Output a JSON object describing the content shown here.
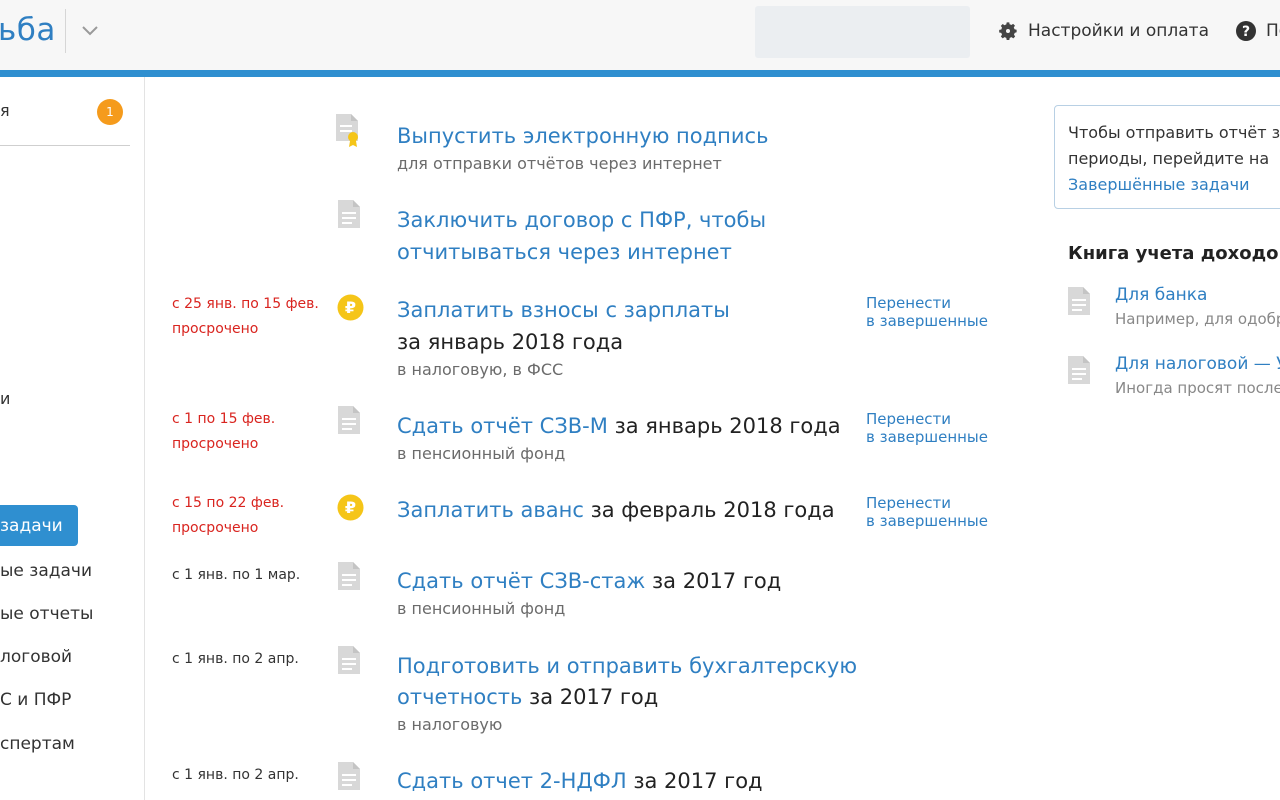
{
  "header": {
    "logo_text": "ьба",
    "settings_label": "Настройки и оплата",
    "help_label": "По"
  },
  "sidebar": {
    "top_item": "я",
    "badge_count": "1",
    "lone_item": "и",
    "active_item": "задачи",
    "items": [
      "ые задачи",
      "ые отчеты",
      "логовой",
      "С и ПФР",
      "спертам"
    ]
  },
  "tasks": [
    {
      "due": [],
      "icon": "document-certificate-icon",
      "title_link": "Выпустить электронную подпись",
      "title_rest": "",
      "title_line2_link": "",
      "title_line2_rest": "",
      "subtitle": "для отправки отчётов через интернет",
      "move": null
    },
    {
      "due": [],
      "icon": "document-icon",
      "title_link": "Заключить договор с ПФР, чтобы",
      "title_rest": "",
      "title_line2_link": "отчитываться через интернет",
      "title_line2_rest": "",
      "subtitle": "",
      "move": null
    },
    {
      "due": [
        "с 25 янв. по 15 фев.",
        "просрочено"
      ],
      "icon": "ruble-coin-icon",
      "title_link": "Заплатить взносы с зарплаты",
      "title_rest": "",
      "title_line2_link": "",
      "title_line2_rest": "за январь 2018 года",
      "subtitle": "в налоговую, в ФСС",
      "move": [
        "Перенести",
        "в завершенные"
      ]
    },
    {
      "due": [
        "с 1 по 15 фев.",
        "просрочено"
      ],
      "icon": "document-icon",
      "title_link": "Сдать отчёт СЗВ-М",
      "title_rest": " за январь 2018 года",
      "title_line2_link": "",
      "title_line2_rest": "",
      "subtitle": "в пенсионный фонд",
      "move": [
        "Перенести",
        "в завершенные"
      ]
    },
    {
      "due": [
        "с 15 по 22 фев.",
        "просрочено"
      ],
      "icon": "ruble-coin-icon",
      "title_link": "Заплатить аванс",
      "title_rest": " за февраль 2018 года",
      "title_line2_link": "",
      "title_line2_rest": "",
      "subtitle": "",
      "move": [
        "Перенести",
        "в завершенные"
      ]
    },
    {
      "due": [
        "с 1 янв. по 1 мар."
      ],
      "icon": "document-icon",
      "title_link": "Сдать отчёт СЗВ-стаж",
      "title_rest": " за 2017 год",
      "title_line2_link": "",
      "title_line2_rest": "",
      "subtitle": "в пенсионный фонд",
      "move": null
    },
    {
      "due": [
        "с 1 янв. по 2 апр."
      ],
      "icon": "document-icon",
      "title_link": "Подготовить и отправить бухгалтерскую",
      "title_rest": "",
      "title_line2_link": "отчетность",
      "title_line2_rest": " за 2017 год",
      "subtitle": "в налоговую",
      "move": null
    },
    {
      "due": [
        "с 1 янв. по 2 апр."
      ],
      "icon": "document-icon",
      "title_link": "Сдать отчет 2-НДФЛ",
      "title_rest": " за 2017 год",
      "title_line2_link": "",
      "title_line2_rest": "",
      "subtitle": "",
      "move": null
    }
  ],
  "info_panel": {
    "line1": "Чтобы отправить отчёт з",
    "line2": "периоды, перейдите на ",
    "link": "Завершённые задачи"
  },
  "book": {
    "title": "Книга учета доходов",
    "items": [
      {
        "link": "Для банка",
        "sub": "Например, для одобр"
      },
      {
        "link": "Для налоговой — У",
        "sub": "Иногда просят после о"
      }
    ]
  },
  "colors": {
    "accent": "#2f8fd0",
    "link": "#2f7fc2",
    "overdue": "#d9241f",
    "badge": "#f59b1c",
    "coin": "#f5c518"
  }
}
